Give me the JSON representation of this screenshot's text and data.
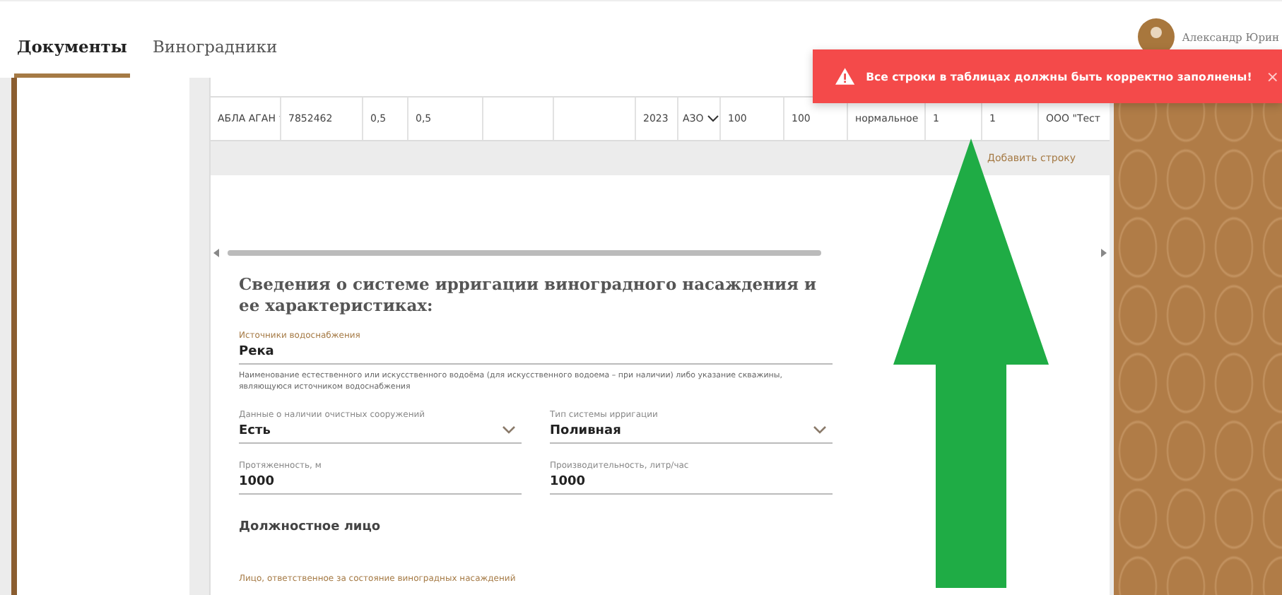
{
  "tabs": [
    {
      "label": "Документы",
      "selected": true
    },
    {
      "label": "Виноградники",
      "selected": false
    }
  ],
  "user": {
    "name": "Александр Юрин"
  },
  "table": {
    "rows": [
      {
        "cells": [
          {
            "kind": "select",
            "value": "АБЛА АГАН"
          },
          {
            "kind": "text",
            "value": "7852462"
          },
          {
            "kind": "text",
            "value": "0,5"
          },
          {
            "kind": "text",
            "value": "0,5"
          },
          {
            "kind": "empty"
          },
          {
            "kind": "empty"
          },
          {
            "kind": "text",
            "value": "2023"
          },
          {
            "kind": "select",
            "value": "АЗО"
          },
          {
            "kind": "text",
            "value": "100"
          },
          {
            "kind": "text",
            "value": "100"
          },
          {
            "kind": "text",
            "value": "нормальное"
          },
          {
            "kind": "text",
            "value": "1"
          },
          {
            "kind": "text",
            "value": "1"
          },
          {
            "kind": "text",
            "value": "ООО \"Тест"
          }
        ]
      }
    ],
    "add_row": "Добавить строку"
  },
  "section": {
    "title": "Сведения о системе ирригации виноградного насаждения и ее характеристиках:",
    "fields": [
      {
        "kind": "text",
        "label": "Источники водоснабжения",
        "value": "Река",
        "hint": "Наименование естественного или искусственного водоёма (для искусственного водоема – при наличии) либо указание скважины, являющуюся источником водоснабжения"
      },
      {
        "kind": "select",
        "label": "Данные о наличии очистных сооружений",
        "value": "Есть"
      },
      {
        "kind": "select",
        "label": "Тип системы ирригации",
        "value": "Поливная"
      },
      {
        "kind": "text",
        "label": "Протяженность, м",
        "value": "1000"
      },
      {
        "kind": "text",
        "label": "Производительность, литр/час",
        "value": "1000"
      }
    ],
    "subtitle": "Должностное лицо",
    "next_label": "Лицо, ответственное за состояние виноградных насаждений"
  },
  "toast": {
    "message": "Все строки в таблицах должны быть корректно заполнены!",
    "close": "×"
  }
}
